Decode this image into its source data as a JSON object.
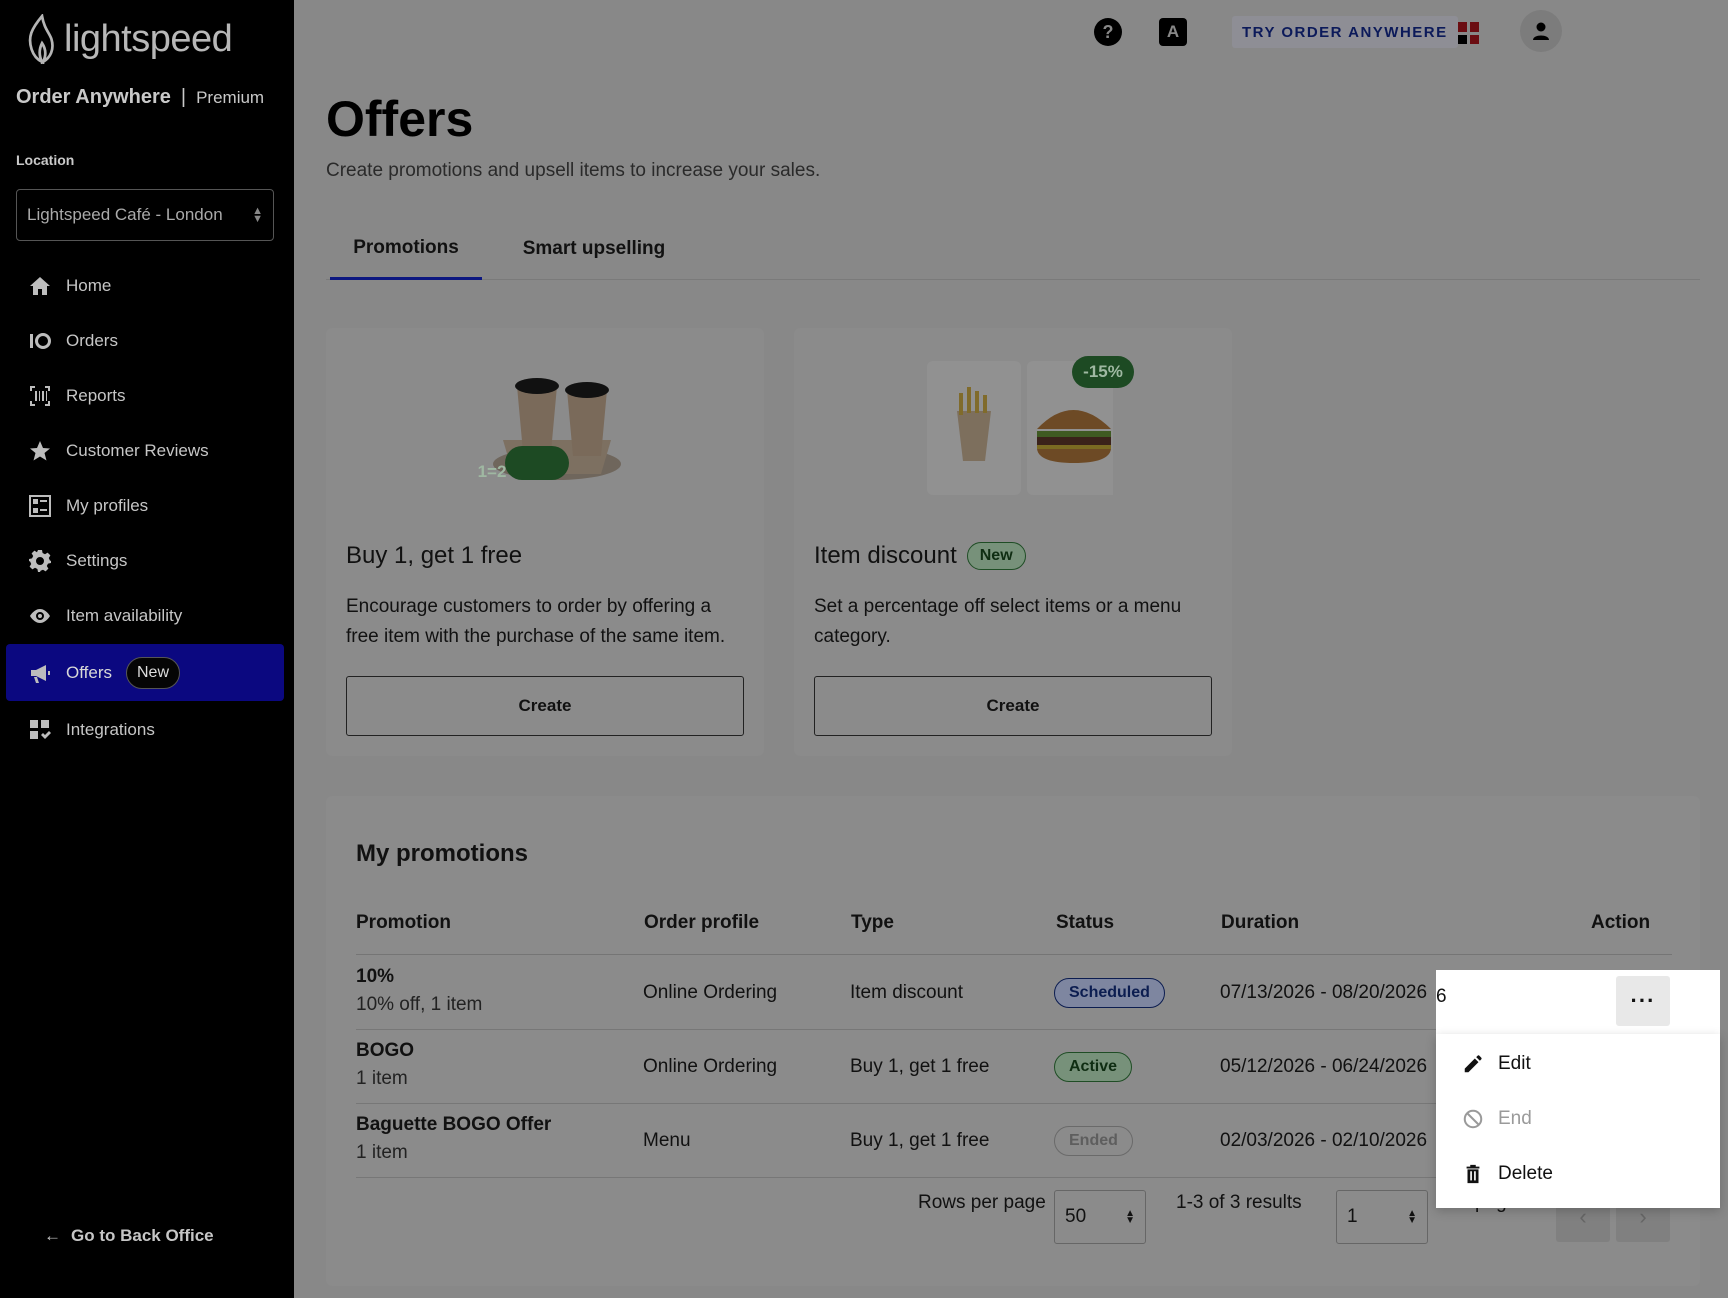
{
  "sidebar": {
    "logo_text": "lightspeed",
    "product_name": "Order Anywhere",
    "product_sep": "|",
    "product_tier": "Premium",
    "location_label": "Location",
    "location_value": "Lightspeed Café - London",
    "nav": [
      {
        "label": "Home",
        "icon": "home-icon"
      },
      {
        "label": "Orders",
        "icon": "orders-icon"
      },
      {
        "label": "Reports",
        "icon": "reports-icon"
      },
      {
        "label": "Customer Reviews",
        "icon": "star-icon"
      },
      {
        "label": "My profiles",
        "icon": "profiles-icon"
      },
      {
        "label": "Settings",
        "icon": "gear-icon"
      },
      {
        "label": "Item availability",
        "icon": "eye-icon"
      },
      {
        "label": "Offers",
        "icon": "megaphone-icon",
        "badge": "New",
        "active": true
      },
      {
        "label": "Integrations",
        "icon": "integrations-icon"
      }
    ],
    "back_office": "Go to Back Office"
  },
  "topbar": {
    "help": "?",
    "translate": "A",
    "try_button": "TRY ORDER ANYWHERE"
  },
  "page": {
    "title": "Offers",
    "subtitle": "Create promotions and upsell items to increase your sales.",
    "tabs": [
      "Promotions",
      "Smart upselling"
    ]
  },
  "cards": [
    {
      "badge": "1=2",
      "title": "Buy 1, get 1 free",
      "description": "Encourage customers to order by offering a free item with the purchase of the same item.",
      "button": "Create"
    },
    {
      "badge": "-15%",
      "title": "Item discount",
      "tag": "New",
      "description": "Set a percentage off select items or a menu category.",
      "button": "Create"
    }
  ],
  "promotions": {
    "title": "My promotions",
    "columns": [
      "Promotion",
      "Order profile",
      "Type",
      "Status",
      "Duration",
      "Action"
    ],
    "rows": [
      {
        "name": "10%",
        "detail": "10% off, 1 item",
        "profile": "Online Ordering",
        "type": "Item discount",
        "status": "Scheduled",
        "duration": "07/13/2026 - 08/20/2026"
      },
      {
        "name": "BOGO",
        "detail": "1 item",
        "profile": "Online Ordering",
        "type": "Buy 1, get 1 free",
        "status": "Active",
        "duration": "05/12/2026 - 06/24/2026"
      },
      {
        "name": "Baguette BOGO Offer",
        "detail": "1 item",
        "profile": "Menu",
        "type": "Buy 1, get 1 free",
        "status": "Ended",
        "duration": "02/03/2026 - 02/10/2026"
      }
    ],
    "pager": {
      "rows_label": "Rows per page",
      "rows_value": "50",
      "results": "1-3 of 3 results",
      "page_value": "1",
      "pages_label": "of 1 pages"
    }
  },
  "action_menu": {
    "more": "···",
    "items": [
      {
        "label": "Edit",
        "icon": "pencil-icon"
      },
      {
        "label": "End",
        "icon": "block-icon",
        "disabled": true
      },
      {
        "label": "Delete",
        "icon": "trash-icon"
      }
    ]
  }
}
